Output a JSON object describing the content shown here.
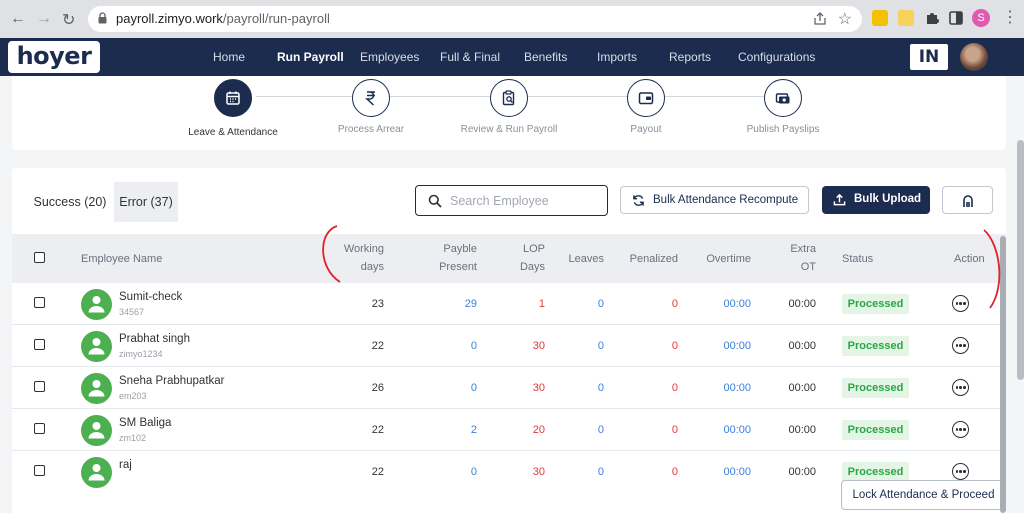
{
  "browser": {
    "url_domain": "payroll.zimyo.work",
    "url_path": "/payroll/run-payroll",
    "profile_initial": "S"
  },
  "app": {
    "logo": "hoyer",
    "nav": [
      "Home",
      "Run Payroll",
      "Employees",
      "Full & Final",
      "Benefits",
      "Imports",
      "Reports",
      "Configurations"
    ],
    "active_nav": "Run Payroll",
    "language": "IN"
  },
  "stepper": {
    "steps": [
      {
        "label": "Leave & Attendance",
        "icon": "calendar-icon",
        "active": true
      },
      {
        "label": "Process Arrear",
        "icon": "rupee-icon",
        "active": false
      },
      {
        "label": "Review & Run Payroll",
        "icon": "clipboard-search-icon",
        "active": false
      },
      {
        "label": "Payout",
        "icon": "wallet-icon",
        "active": false
      },
      {
        "label": "Publish Payslips",
        "icon": "payslip-icon",
        "active": false
      }
    ]
  },
  "toolbar": {
    "tab_success": "Success (20)",
    "tab_error": "Error (37)",
    "search_placeholder": "Search Employee",
    "recompute_label": "Bulk Attendance Recompute",
    "upload_label": "Bulk Upload",
    "lock_label": "Lock Attendance & Proceed"
  },
  "table": {
    "headers": {
      "name": "Employee Name",
      "working_days": [
        "Working",
        "days"
      ],
      "payble_present": [
        "Payble",
        "Present"
      ],
      "lop_days": [
        "LOP",
        "Days"
      ],
      "leaves": "Leaves",
      "penalized": "Penalized",
      "overtime": "Overtime",
      "extra_ot": [
        "Extra",
        "OT"
      ],
      "status": "Status",
      "action": "Action"
    },
    "rows": [
      {
        "name": "Sumit-check",
        "code": "34567",
        "working_days": "23",
        "payble_present": "29",
        "lop_days": "1",
        "leaves": "0",
        "penalized": "0",
        "overtime": "00:00",
        "extra_ot": "00:00",
        "status": "Processed"
      },
      {
        "name": "Prabhat singh",
        "code": "zimyo1234",
        "working_days": "22",
        "payble_present": "0",
        "lop_days": "30",
        "leaves": "0",
        "penalized": "0",
        "overtime": "00:00",
        "extra_ot": "00:00",
        "status": "Processed"
      },
      {
        "name": "Sneha Prabhupatkar",
        "code": "em203",
        "working_days": "26",
        "payble_present": "0",
        "lop_days": "30",
        "leaves": "0",
        "penalized": "0",
        "overtime": "00:00",
        "extra_ot": "00:00",
        "status": "Processed"
      },
      {
        "name": "SM Baliga",
        "code": "zm102",
        "working_days": "22",
        "payble_present": "2",
        "lop_days": "20",
        "leaves": "0",
        "penalized": "0",
        "overtime": "00:00",
        "extra_ot": "00:00",
        "status": "Processed"
      },
      {
        "name": "raj",
        "code": "",
        "working_days": "22",
        "payble_present": "0",
        "lop_days": "30",
        "leaves": "0",
        "penalized": "0",
        "overtime": "00:00",
        "extra_ot": "00:00",
        "status": "Processed"
      }
    ]
  },
  "colors": {
    "navy": "#1c2c4f",
    "processed_green": "#28a745",
    "value_blue": "#3b7fe0",
    "value_red": "#e03a3a",
    "annotation_red": "#e0202a"
  }
}
